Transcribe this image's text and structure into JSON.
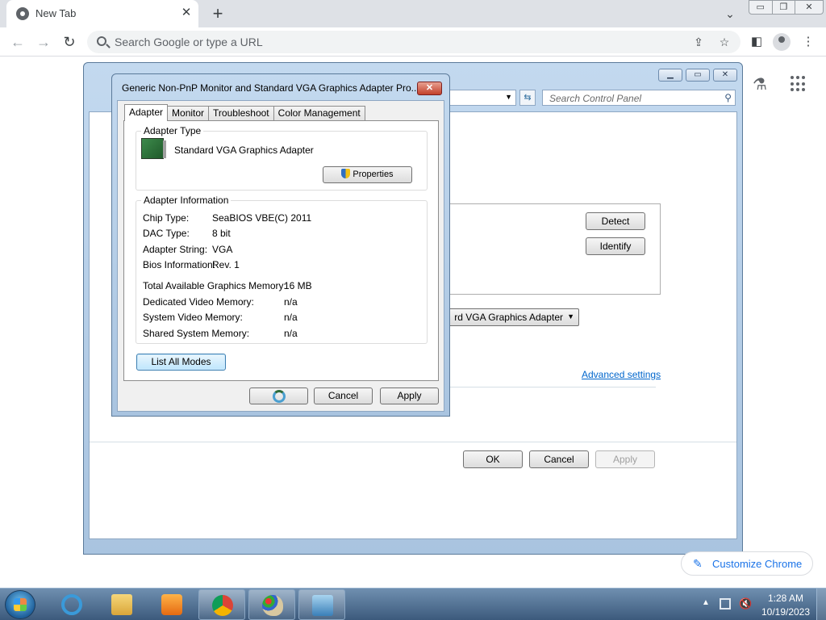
{
  "browser": {
    "tab_title": "New Tab",
    "omnibox_placeholder": "Search Google or type a URL",
    "customize_label": "Customize Chrome"
  },
  "control_panel": {
    "search_placeholder": "Search Control Panel",
    "detect_label": "Detect",
    "identify_label": "Identify",
    "display_value": "rd VGA Graphics Adapter",
    "advanced_link": "Advanced settings",
    "ok_label": "OK",
    "cancel_label": "Cancel",
    "apply_label": "Apply"
  },
  "dialog": {
    "title": "Generic Non-PnP Monitor and Standard VGA Graphics Adapter Pro...",
    "tabs": [
      "Adapter",
      "Monitor",
      "Troubleshoot",
      "Color Management"
    ],
    "adapter_type": {
      "label": "Adapter Type",
      "name": "Standard VGA Graphics Adapter",
      "properties_label": "Properties"
    },
    "adapter_info": {
      "label": "Adapter Information",
      "rows": [
        {
          "k": "Chip Type:",
          "v": "SeaBIOS VBE(C) 2011"
        },
        {
          "k": "DAC Type:",
          "v": "8 bit"
        },
        {
          "k": "Adapter String:",
          "v": "VGA"
        },
        {
          "k": "Bios Information:",
          "v": "Rev. 1"
        }
      ],
      "memory": [
        {
          "k": "Total Available Graphics Memory:",
          "v": "16 MB"
        },
        {
          "k": "Dedicated Video Memory:",
          "v": "n/a"
        },
        {
          "k": "System Video Memory:",
          "v": "n/a"
        },
        {
          "k": "Shared System Memory:",
          "v": "n/a"
        }
      ]
    },
    "list_modes_label": "List All Modes",
    "cancel_label": "Cancel",
    "apply_label": "Apply"
  },
  "taskbar": {
    "time": "1:28 AM",
    "date": "10/19/2023"
  }
}
